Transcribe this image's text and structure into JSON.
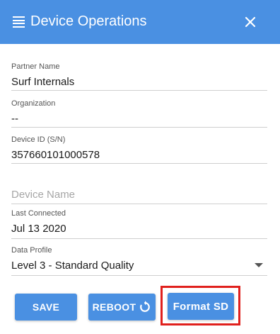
{
  "header": {
    "title": "Device Operations",
    "background_color": "#4a90e2",
    "menu_icon": "hamburger-menu-icon",
    "close_icon": "close-icon"
  },
  "fields": {
    "partner_name": {
      "label": "Partner Name",
      "value": "Surf Internals"
    },
    "organization": {
      "label": "Organization",
      "value": "--"
    },
    "device_id": {
      "label": "Device ID (S/N)",
      "value": "357660101000578"
    },
    "device_name": {
      "placeholder": "Device Name",
      "value": ""
    },
    "last_connected": {
      "label": "Last Connected",
      "value": "Jul 13 2020"
    },
    "data_profile": {
      "label": "Data Profile",
      "selected": "Level 3 - Standard Quality"
    }
  },
  "actions": {
    "save_label": "SAVE",
    "reboot_label": "REBOOT",
    "reboot_icon": "refresh-icon",
    "format_label": "Format SD",
    "highlight_color": "#e0201d"
  }
}
